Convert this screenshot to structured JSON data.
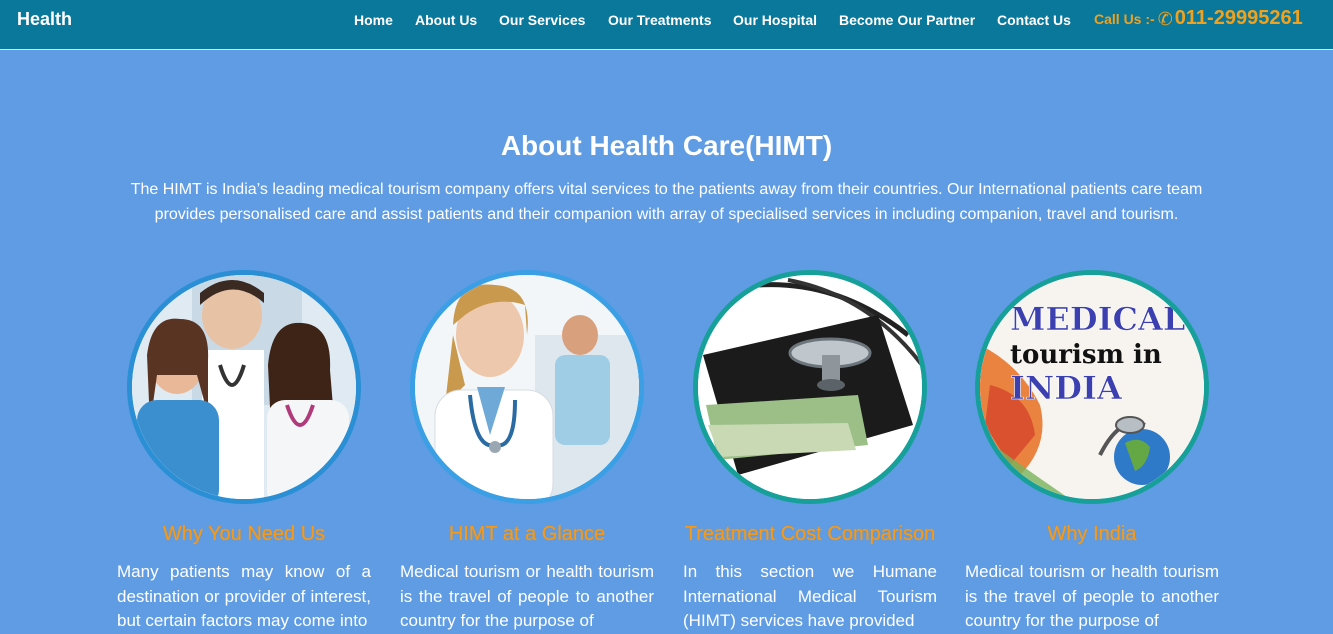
{
  "header": {
    "brand": "Health",
    "nav": [
      "Home",
      "About Us",
      "Our Services",
      "Our Treatments",
      "Our Hospital",
      "Become Our Partner",
      "Contact Us"
    ],
    "call_label": "Call Us :-",
    "phone_icon": "phone-icon",
    "phone": "011-29995261"
  },
  "about": {
    "title": "About Health Care(HIMT)",
    "intro": "The HIMT is India’s leading medical tourism company offers vital services to the patients away from their countries. Our International patients care team provides personalised care and assist patients and their companion with array of specialised services in including companion, travel and tourism."
  },
  "cards": [
    {
      "title": "Why You Need Us",
      "text": "Many patients may know of a destination or provider of interest, but certain factors may come into"
    },
    {
      "title": "HIMT at a Glance",
      "text": "Medical tourism or health tourism is the travel of people to another country for the purpose of"
    },
    {
      "title": "Treatment Cost Comparison",
      "text": "In this section we Humane International Medical Tourism (HIMT) services have provided"
    },
    {
      "title": "Why India",
      "text": "Medical tourism or health tourism is the travel of people to another country for the purpose of",
      "image_text": [
        "MEDICAL",
        "tourism in",
        "INDIA"
      ]
    }
  ],
  "colors": {
    "nav_bg": "#0a789a",
    "page_bg": "#5f9ce3",
    "accent_orange": "#f59a1c",
    "call_orange": "#f0a21e"
  }
}
